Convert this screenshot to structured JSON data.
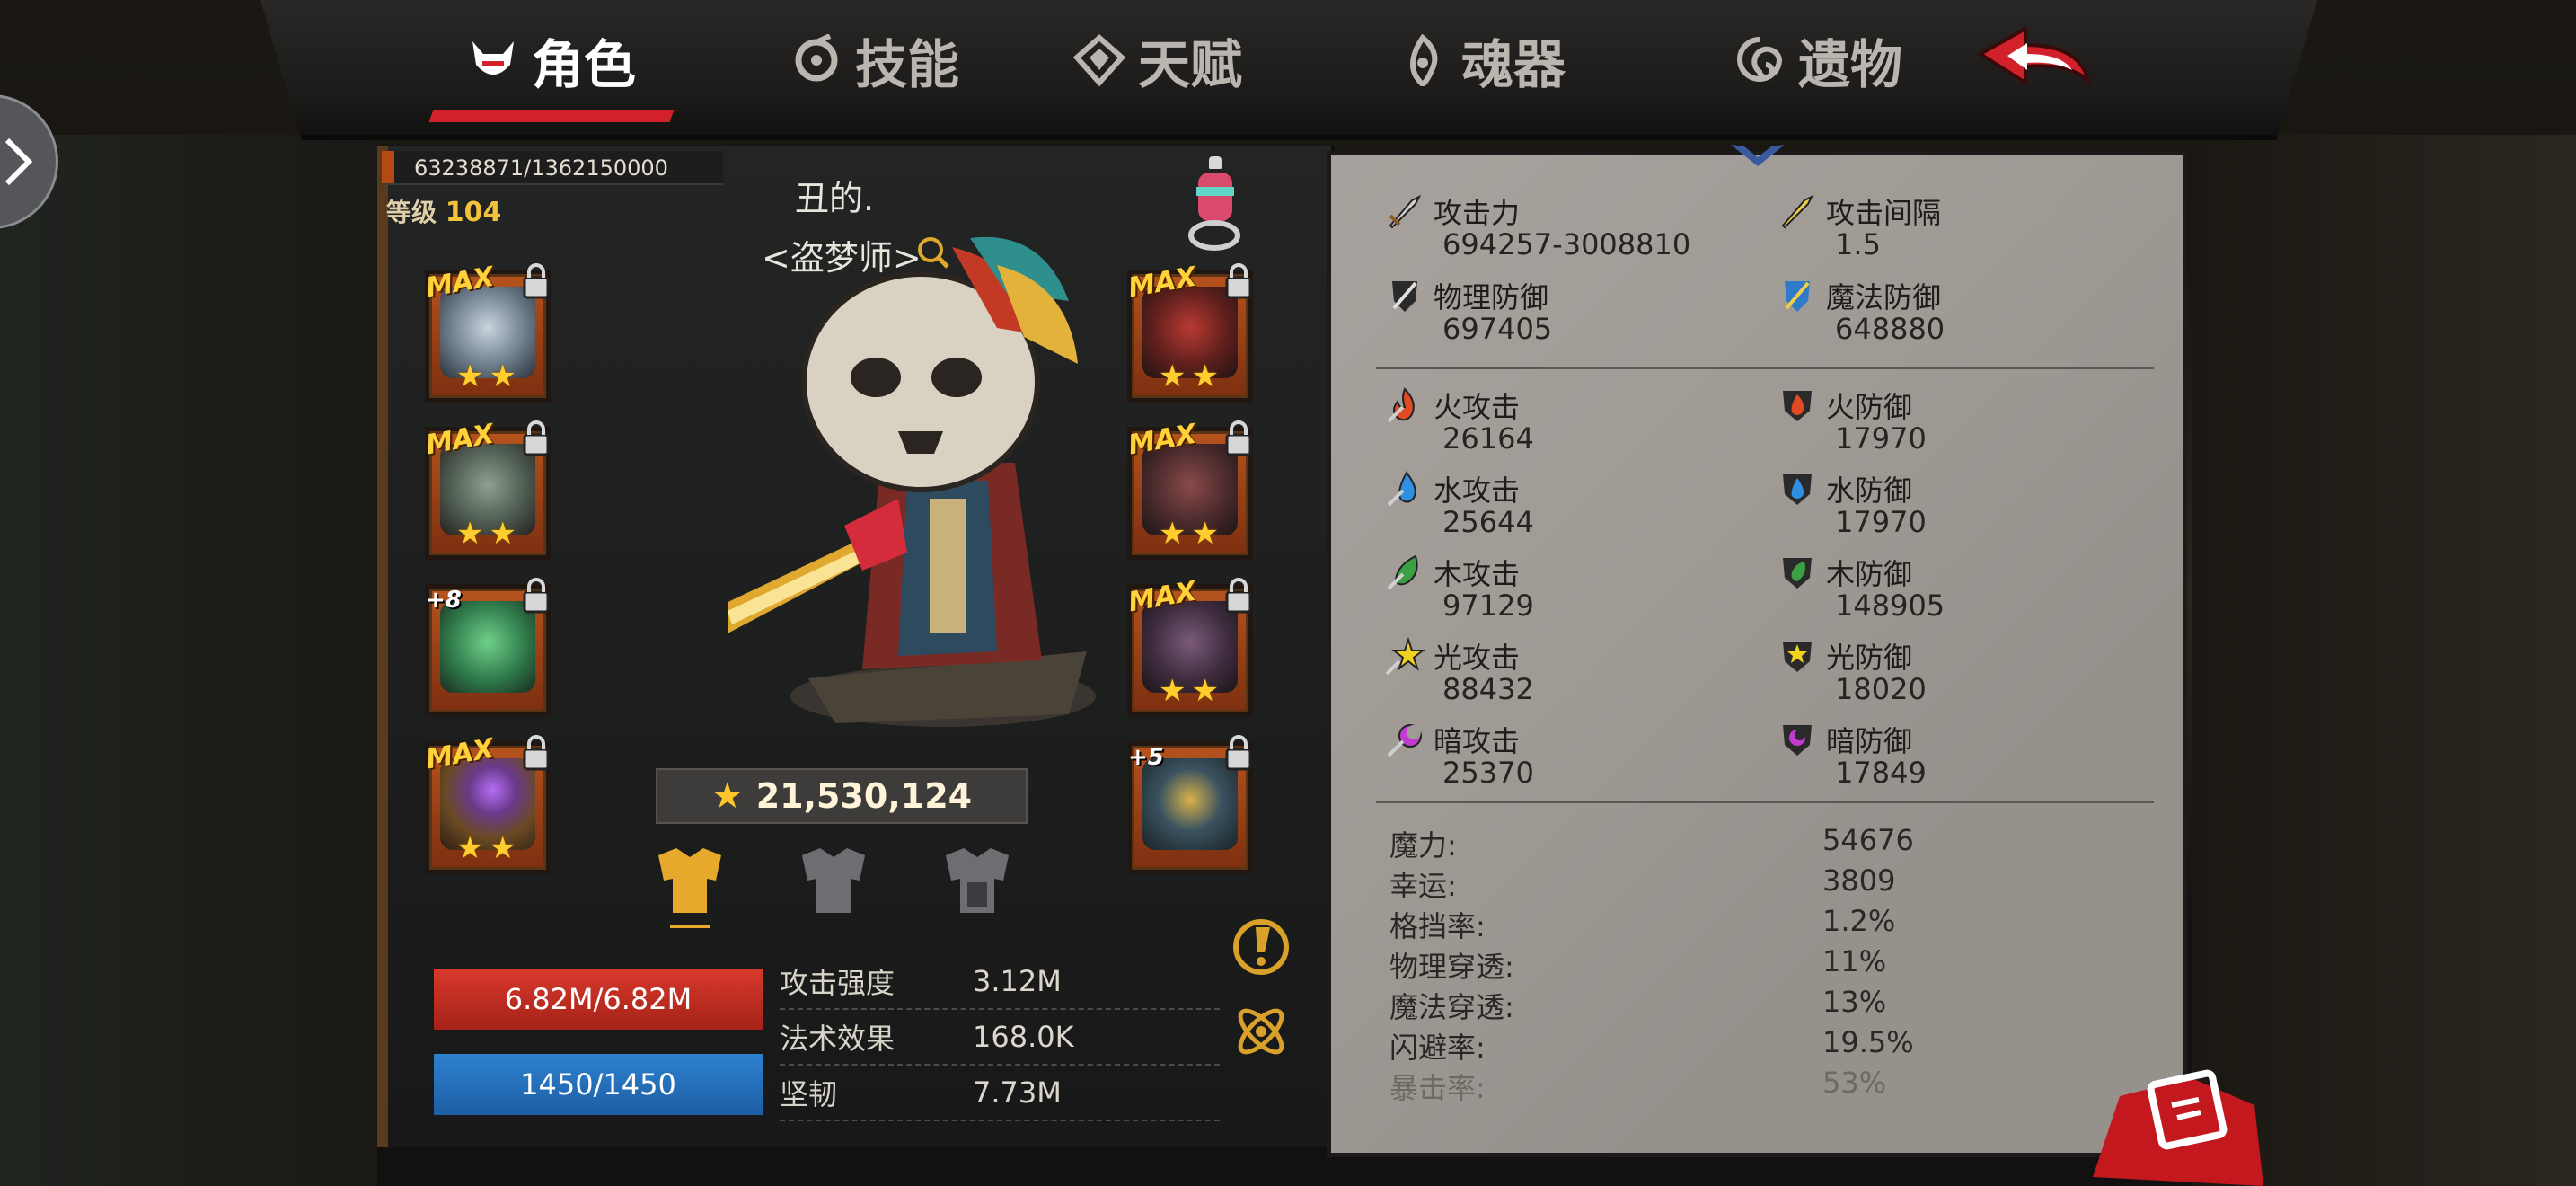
{
  "tabs": [
    {
      "label": "角色",
      "icon": "devil-mask-icon",
      "active": true
    },
    {
      "label": "技能",
      "icon": "swirl-icon"
    },
    {
      "label": "天赋",
      "icon": "talent-diamond-icon"
    },
    {
      "label": "魂器",
      "icon": "soul-flame-icon"
    },
    {
      "label": "遗物",
      "icon": "relic-spiral-icon"
    }
  ],
  "character": {
    "exp": "63238871/1362150000",
    "exp_progress": 0.0464,
    "level_label": "等级",
    "level": "104",
    "name": "丑的.",
    "title": "<盗梦师>",
    "power": "21,530,124",
    "hp": "6.82M/6.82M",
    "mp": "1450/1450"
  },
  "equipment_left": [
    {
      "tag": "MAX",
      "stars": "★★",
      "icon": "helmet-icon",
      "color": "#8fa3b5"
    },
    {
      "tag": "MAX",
      "stars": "★★",
      "icon": "gauntlet-icon",
      "color": "#6d7e6f"
    },
    {
      "tag": "+8",
      "stars": "",
      "icon": "green-claw-weapon-icon",
      "color": "#3f8a5a"
    },
    {
      "tag": "MAX",
      "stars": "★★",
      "icon": "purple-gem-amulet-icon",
      "color": "#8a5a2a"
    }
  ],
  "equipment_right": [
    {
      "tag": "MAX",
      "stars": "★★",
      "icon": "shoulder-armor-icon",
      "color": "#7a2b28"
    },
    {
      "tag": "MAX",
      "stars": "★★",
      "icon": "chest-armor-icon",
      "color": "#5b3a3a"
    },
    {
      "tag": "MAX",
      "stars": "★★",
      "icon": "boots-icon",
      "color": "#4e3a4c"
    },
    {
      "tag": "+5",
      "stars": "",
      "icon": "winged-crest-icon",
      "color": "#3a5360"
    }
  ],
  "mini_stats": [
    {
      "label": "攻击强度",
      "value": "3.12M"
    },
    {
      "label": "法术效果",
      "value": "168.0K"
    },
    {
      "label": "坚韧",
      "value": "7.73M"
    }
  ],
  "main_stats": [
    {
      "label": "攻击力",
      "value": "694257-3008810",
      "icon": "sword-icon"
    },
    {
      "label": "攻击间隔",
      "value": "1.5",
      "icon": "golden-sword-icon"
    },
    {
      "label": "物理防御",
      "value": "697405",
      "icon": "shield-sword-icon"
    },
    {
      "label": "魔法防御",
      "value": "648880",
      "icon": "magic-shield-icon"
    }
  ],
  "element_stats": [
    {
      "label": "火攻击",
      "value": "26164",
      "icon": "fire-attack-icon",
      "color": "#e24a25"
    },
    {
      "label": "火防御",
      "value": "17970",
      "icon": "fire-defense-icon",
      "color": "#e24a25"
    },
    {
      "label": "水攻击",
      "value": "25644",
      "icon": "water-attack-icon",
      "color": "#2f8fe0"
    },
    {
      "label": "水防御",
      "value": "17970",
      "icon": "water-defense-icon",
      "color": "#2f8fe0"
    },
    {
      "label": "木攻击",
      "value": "97129",
      "icon": "wood-attack-icon",
      "color": "#3aa043"
    },
    {
      "label": "木防御",
      "value": "148905",
      "icon": "wood-defense-icon",
      "color": "#3aa043"
    },
    {
      "label": "光攻击",
      "value": "88432",
      "icon": "light-attack-icon",
      "color": "#f0d21e"
    },
    {
      "label": "光防御",
      "value": "18020",
      "icon": "light-defense-icon",
      "color": "#f0d21e"
    },
    {
      "label": "暗攻击",
      "value": "25370",
      "icon": "dark-attack-icon",
      "color": "#c23ad0"
    },
    {
      "label": "暗防御",
      "value": "17849",
      "icon": "dark-defense-icon",
      "color": "#c23ad0"
    }
  ],
  "extra_stats": [
    {
      "label": "魔力:",
      "value": "54676"
    },
    {
      "label": "幸运:",
      "value": "3809"
    },
    {
      "label": "格挡率:",
      "value": "1.2%"
    },
    {
      "label": "物理穿透:",
      "value": "11%"
    },
    {
      "label": "魔法穿透:",
      "value": "13%"
    },
    {
      "label": "闪避率:",
      "value": "19.5%"
    },
    {
      "label": "暴击率:",
      "value": "53%"
    }
  ]
}
